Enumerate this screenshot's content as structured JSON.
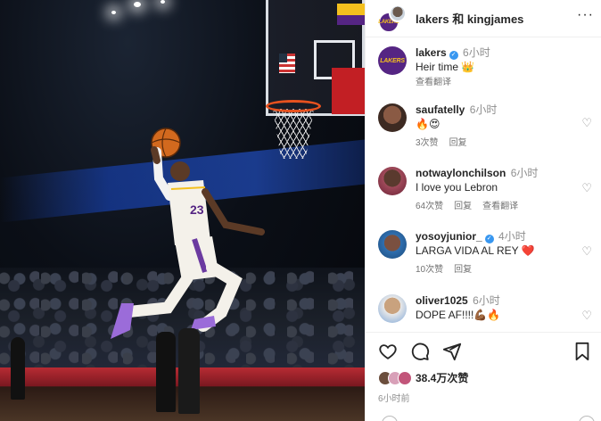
{
  "post": {
    "header_title": "lakers 和 kingjames",
    "caption": {
      "user": "lakers",
      "time": "6小时",
      "text": "Heir time 👑",
      "translate": "查看翻译"
    }
  },
  "comments": [
    {
      "user": "saufatelly",
      "time": "6小时",
      "text": "🔥😍",
      "likes": "3次赞",
      "reply": "回复",
      "translate": "",
      "verified": false
    },
    {
      "user": "notwaylonchilson",
      "time": "6小时",
      "text": "I love you Lebron",
      "likes": "64次赞",
      "reply": "回复",
      "translate": "查看翻译",
      "verified": false
    },
    {
      "user": "yosoyjunior_",
      "time": "4小时",
      "text": "LARGA VIDA AL REY ❤️",
      "likes": "10次赞",
      "reply": "回复",
      "translate": "",
      "verified": true
    },
    {
      "user": "oliver1025",
      "time": "6小时",
      "text": "DOPE AF!!!!💪🏾🔥",
      "likes": "",
      "reply": "",
      "translate": "",
      "verified": false
    }
  ],
  "footer": {
    "likes": "38.4万次赞",
    "posted": "6小时前"
  },
  "icons": {
    "like": "heart-icon",
    "comment": "comment-icon",
    "share": "share-icon",
    "save": "bookmark-icon",
    "more": "more-icon",
    "verified": "verified-badge-icon"
  },
  "colors": {
    "lakers_purple": "#552583",
    "lakers_gold": "#f4c01e",
    "verified_blue": "#3897f0",
    "muted": "#8e8e8e"
  }
}
